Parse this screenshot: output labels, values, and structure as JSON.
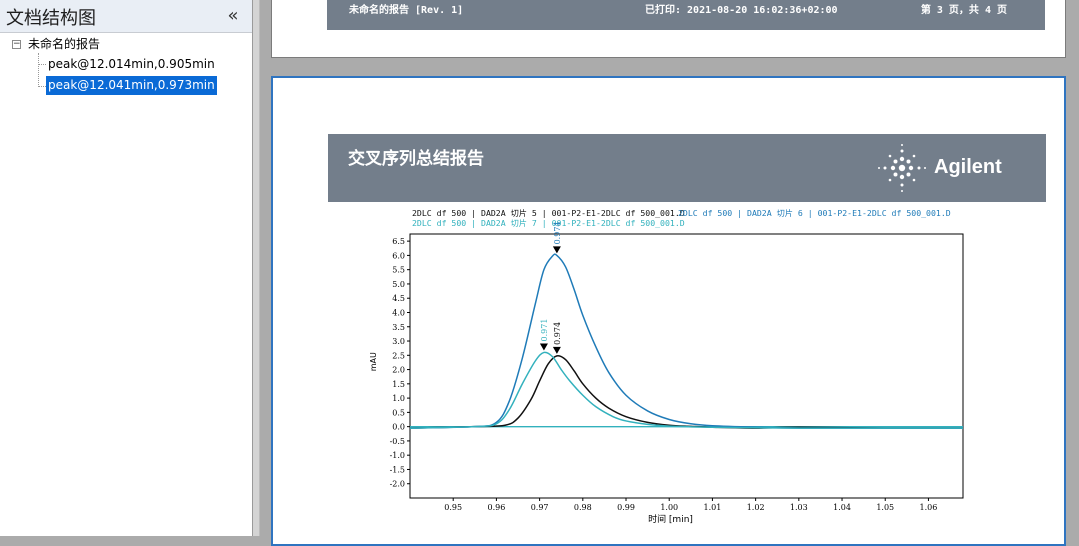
{
  "sidebar": {
    "title": "文档结构图",
    "collapse_glyph": "«",
    "tree": {
      "root_label": "未命名的报告",
      "expander": "−",
      "children": [
        {
          "label": "peak@12.014min,0.905min",
          "selected": false
        },
        {
          "label": "peak@12.041min,0.973min",
          "selected": true
        }
      ]
    }
  },
  "page3_header": {
    "report_name": "未命名的报告 [Rev. 1]",
    "printed": "已打印:  2021-08-20 16:02:36+02:00",
    "page_info": "第 3 页，共 4 页"
  },
  "report": {
    "title": "交叉序列总结报告",
    "brand": "Agilent"
  },
  "colors": {
    "banner": "#737e8b",
    "series_black": "#111111",
    "series_blue": "#1f7bb8",
    "series_teal": "#32b1bd",
    "selection": "#0a6ad6"
  },
  "chart_data": {
    "type": "line",
    "legend": [
      {
        "text": "2DLC df 500 | DAD2A 切片 5 | 001-P2-E1-2DLC df 500_001.D",
        "color": "#111111"
      },
      {
        "text": "2DLC df 500 | DAD2A 切片 6 | 001-P2-E1-2DLC df 500_001.D",
        "color": "#1f7bb8"
      },
      {
        "text": "2DLC df 500 | DAD2A 切片 7 | 001-P2-E1-2DLC df 500_001.D",
        "color": "#32b1bd"
      }
    ],
    "xlabel": "时间 [min]",
    "ylabel": "mAU",
    "xlim": [
      0.94,
      1.068
    ],
    "ylim": [
      -2.5,
      6.75
    ],
    "xticks": [
      0.95,
      0.96,
      0.97,
      0.98,
      0.99,
      1.0,
      1.01,
      1.02,
      1.03,
      1.04,
      1.05,
      1.06
    ],
    "yticks": [
      6.5,
      6.0,
      5.5,
      5.0,
      4.5,
      4.0,
      3.5,
      3.0,
      2.5,
      2.0,
      1.5,
      1.0,
      0.5,
      0.0,
      -0.5,
      -1.0,
      -1.5,
      -2.0
    ],
    "series": [
      {
        "name": "2DLC df 500 | DAD2A 切片 5 | 001-P2-E1-2DLC df 500_001.D",
        "color": "#111111",
        "x": [
          0.94,
          0.955,
          0.962,
          0.965,
          0.968,
          0.97,
          0.972,
          0.974,
          0.976,
          0.978,
          0.98,
          0.983,
          0.986,
          0.99,
          0.995,
          1.0,
          1.005,
          1.01,
          1.02,
          1.03,
          1.05,
          1.068
        ],
        "y": [
          -0.05,
          0.0,
          0.05,
          0.3,
          0.95,
          1.6,
          2.2,
          2.48,
          2.35,
          1.95,
          1.5,
          1.0,
          0.65,
          0.35,
          0.15,
          0.05,
          0.01,
          -0.02,
          -0.05,
          -0.02,
          -0.05,
          -0.05
        ],
        "peak_label": "0.974",
        "peak_x": 0.974,
        "peak_y": 2.48
      },
      {
        "name": "2DLC df 500 | DAD2A 切片 6 | 001-P2-E1-2DLC df 500_001.D",
        "color": "#1f7bb8",
        "x": [
          0.94,
          0.955,
          0.96,
          0.963,
          0.966,
          0.969,
          0.971,
          0.973,
          0.974,
          0.976,
          0.978,
          0.98,
          0.983,
          0.986,
          0.99,
          0.995,
          1.0,
          1.005,
          1.01,
          1.02,
          1.03,
          1.05,
          1.068
        ],
        "y": [
          -0.05,
          0.0,
          0.15,
          0.9,
          2.4,
          4.3,
          5.5,
          5.98,
          6.0,
          5.6,
          4.8,
          3.9,
          2.8,
          1.9,
          1.1,
          0.55,
          0.25,
          0.1,
          0.03,
          -0.02,
          -0.05,
          -0.05,
          -0.05
        ],
        "peak_label": "0.974",
        "peak_x": 0.974,
        "peak_y": 6.0
      },
      {
        "name": "2DLC df 500 | DAD2A 切片 7 | 001-P2-E1-2DLC df 500_001.D",
        "color": "#32b1bd",
        "x": [
          0.94,
          0.955,
          0.96,
          0.963,
          0.966,
          0.969,
          0.971,
          0.973,
          0.975,
          0.977,
          0.98,
          0.983,
          0.987,
          0.99,
          0.995,
          1.0,
          1.01,
          1.02,
          1.03,
          1.05,
          1.068
        ],
        "y": [
          -0.05,
          0.0,
          0.1,
          0.6,
          1.5,
          2.3,
          2.6,
          2.45,
          2.0,
          1.6,
          1.1,
          0.7,
          0.35,
          0.2,
          0.08,
          0.02,
          -0.02,
          -0.04,
          -0.05,
          -0.05,
          -0.05
        ],
        "peak_label": "0.971",
        "peak_x": 0.971,
        "peak_y": 2.6
      }
    ]
  }
}
